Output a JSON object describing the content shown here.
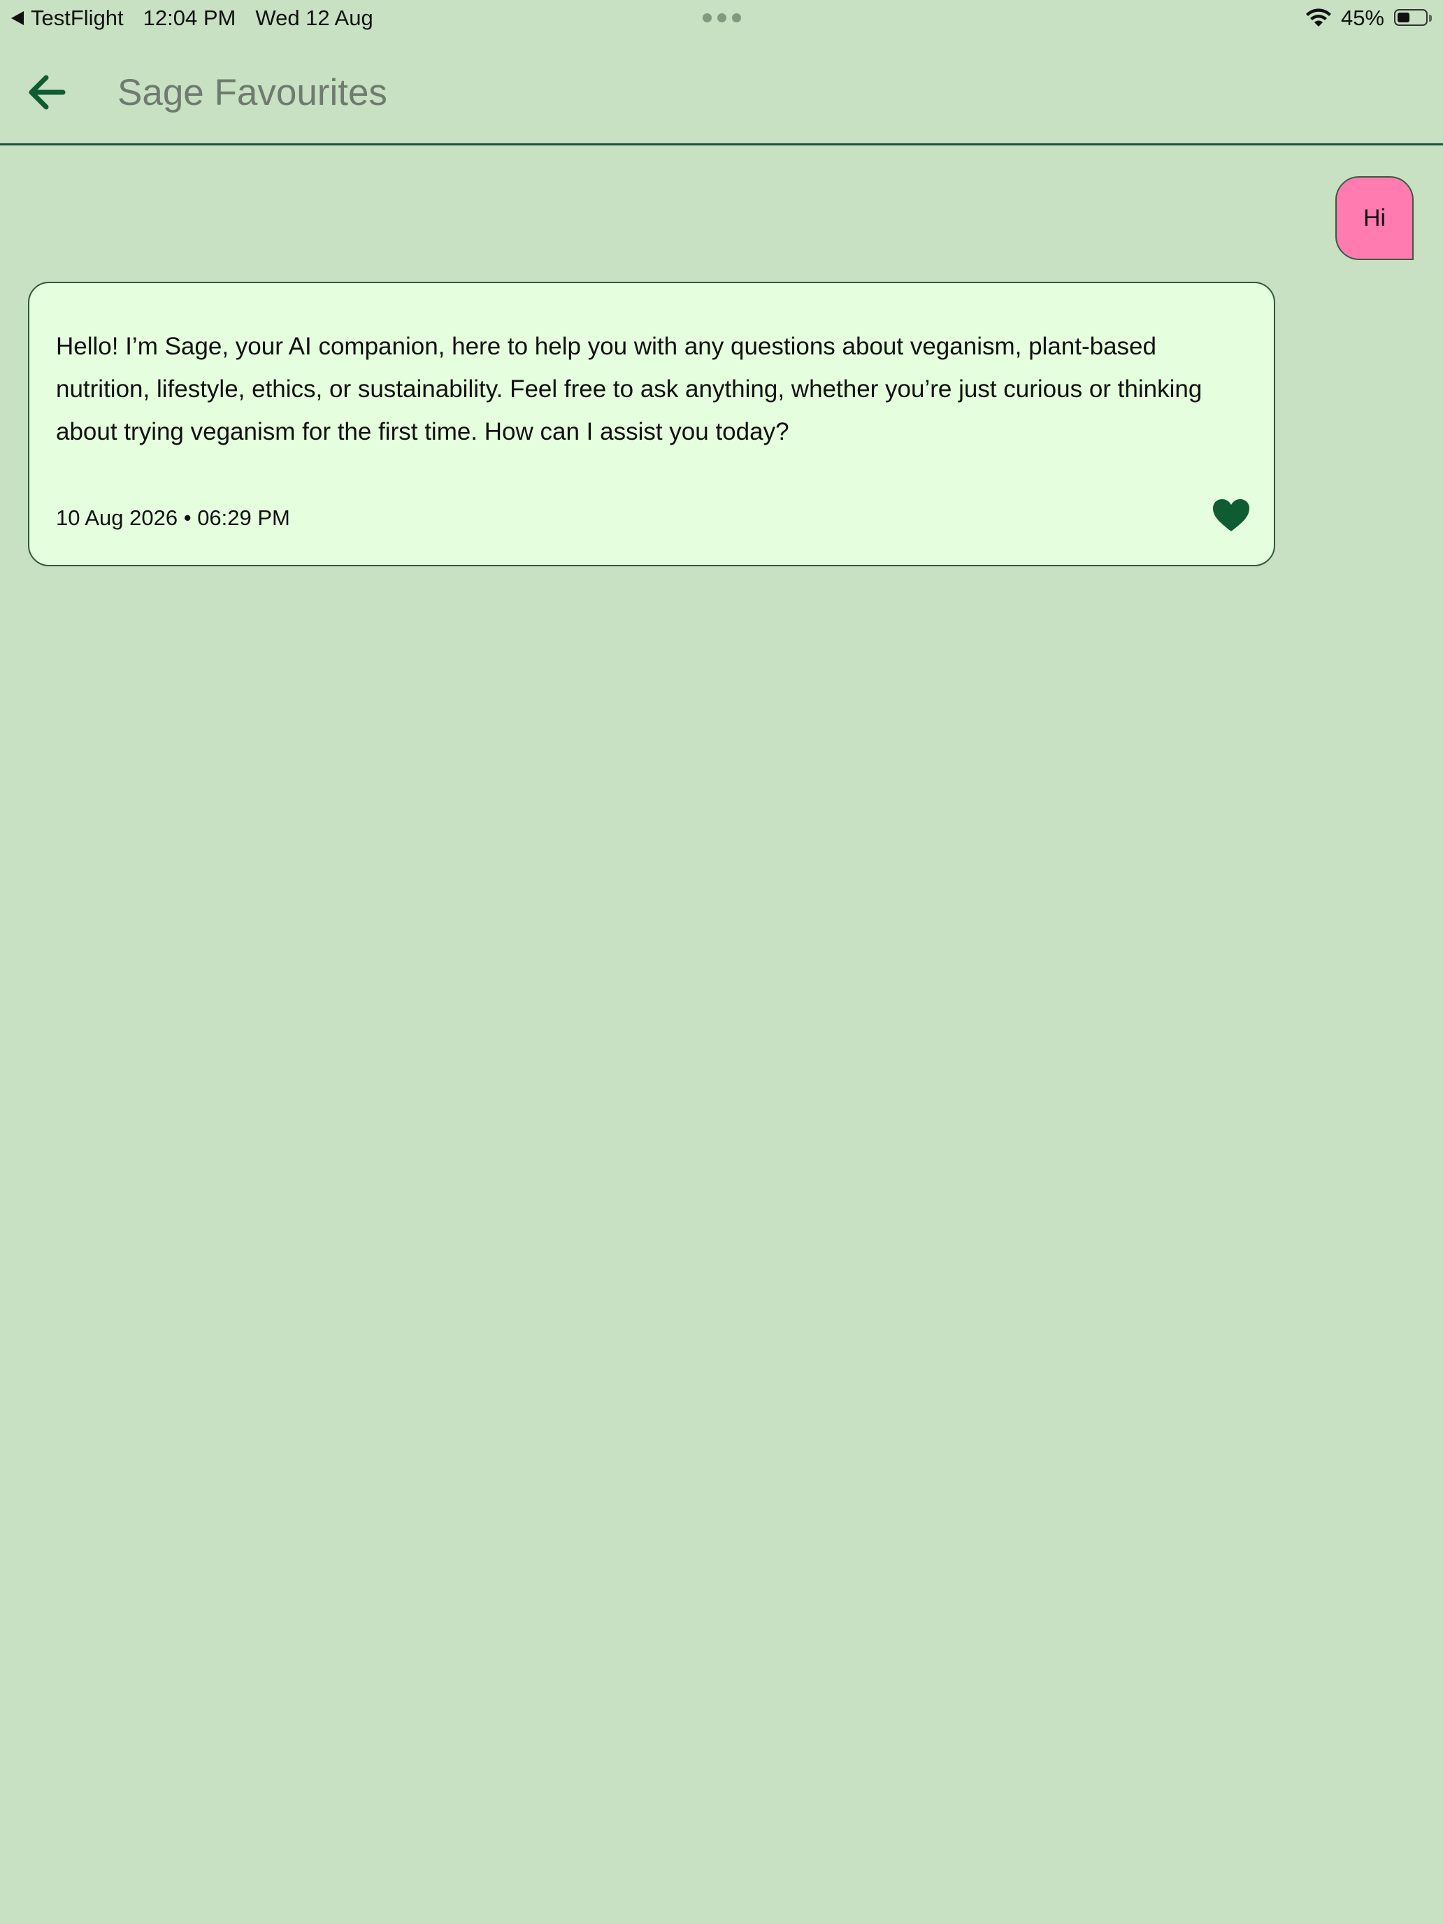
{
  "status_bar": {
    "back_app": "TestFlight",
    "time": "12:04 PM",
    "date": "Wed 12 Aug",
    "battery_percent": "45%",
    "battery_level": 0.45
  },
  "header": {
    "title": "Sage Favourites"
  },
  "messages": {
    "user": {
      "text": "Hi",
      "color": "#ff7bb0"
    },
    "ai": {
      "text": "Hello! I’m Sage, your AI companion, here to help you with any questions about veganism, plant-based nutrition, lifestyle, ethics, or sustainability. Feel free to ask anything, whether you’re just curious or thinking about trying veganism for the first time. How can I assist you today?",
      "timestamp": "10 Aug 2026 • 06:29 PM",
      "favourited": true
    }
  },
  "colors": {
    "background": "#c7e1c2",
    "accent": "#0f5b32",
    "card": "#e5fedd"
  },
  "icons": {
    "back": "arrow-left-icon",
    "favourite": "heart-icon",
    "wifi": "wifi-icon",
    "battery": "battery-icon"
  }
}
